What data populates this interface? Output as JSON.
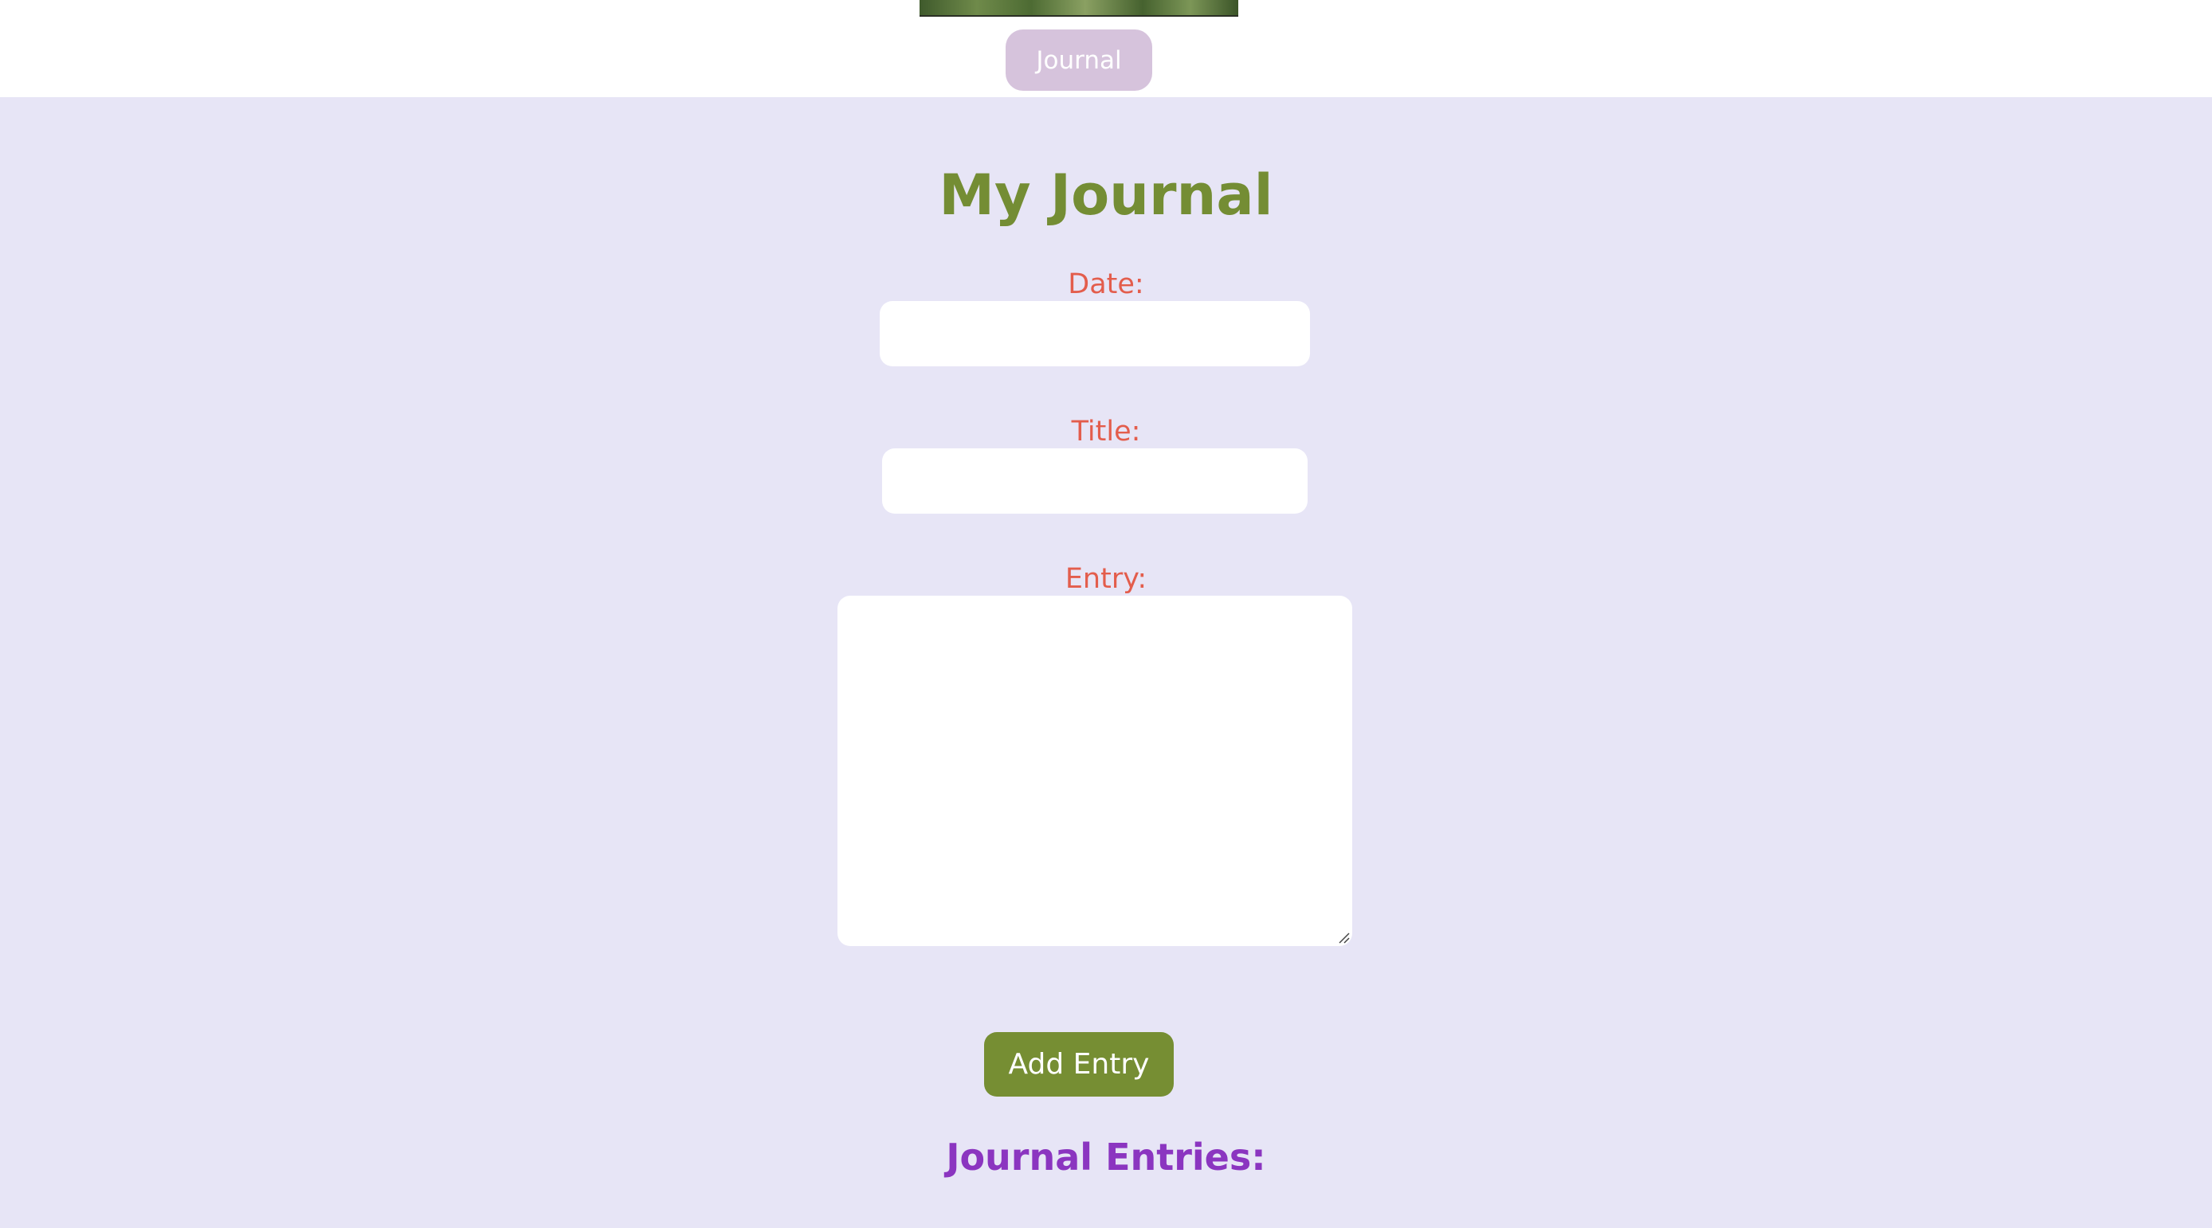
{
  "header": {
    "nav_button_label": "Journal"
  },
  "main": {
    "title": "My Journal",
    "form": {
      "date_label": "Date:",
      "date_value": "",
      "title_label": "Title:",
      "title_value": "",
      "entry_label": "Entry:",
      "entry_value": "",
      "submit_label": "Add Entry"
    },
    "entries_heading": "Journal Entries:"
  },
  "colors": {
    "page_background": "#e7e5f6",
    "title": "#748d34",
    "labels": "#e35d4c",
    "nav_button": "#d6c3dc",
    "submit_button": "#768e33",
    "entries_heading": "#8b35c0"
  },
  "icons": {
    "textarea_resize": "resize-handle-icon"
  }
}
